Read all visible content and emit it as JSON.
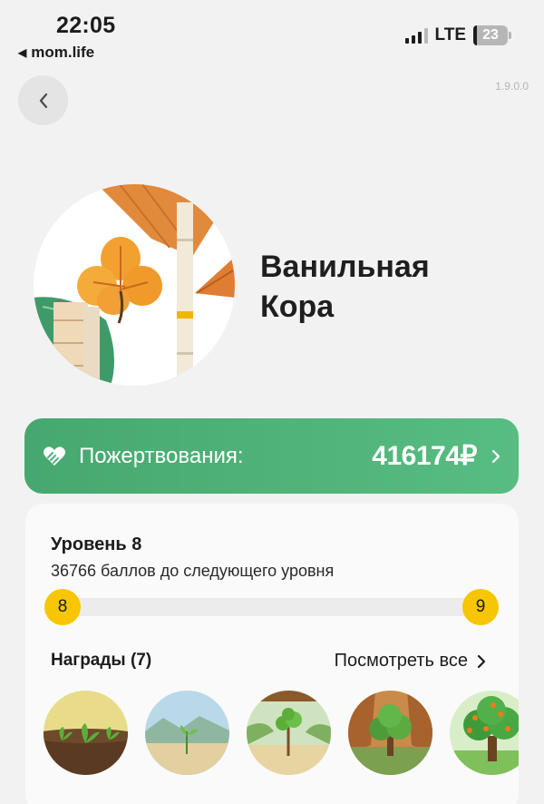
{
  "status_bar": {
    "time": "22:05",
    "back_app": "mom.life",
    "network": "LTE",
    "battery": "23"
  },
  "header": {
    "version": "1.9.0.0"
  },
  "profile": {
    "name_line1": "Ванильная",
    "name_line2": "Кора"
  },
  "donations": {
    "label": "Пожертвования:",
    "amount": "416174₽"
  },
  "level": {
    "title": "Уровень 8",
    "subtitle": "36766 баллов до следующего уровня",
    "current": "8",
    "next": "9",
    "progress": 0.05
  },
  "awards": {
    "title": "Награды (7)",
    "see_all": "Посмотреть все",
    "items": [
      "seedlings-award",
      "sprout-award",
      "young-tree-award",
      "tree-award",
      "fruit-tree-award"
    ]
  },
  "colors": {
    "accent_green": "#4fb378",
    "level_yellow": "#f7c600"
  }
}
